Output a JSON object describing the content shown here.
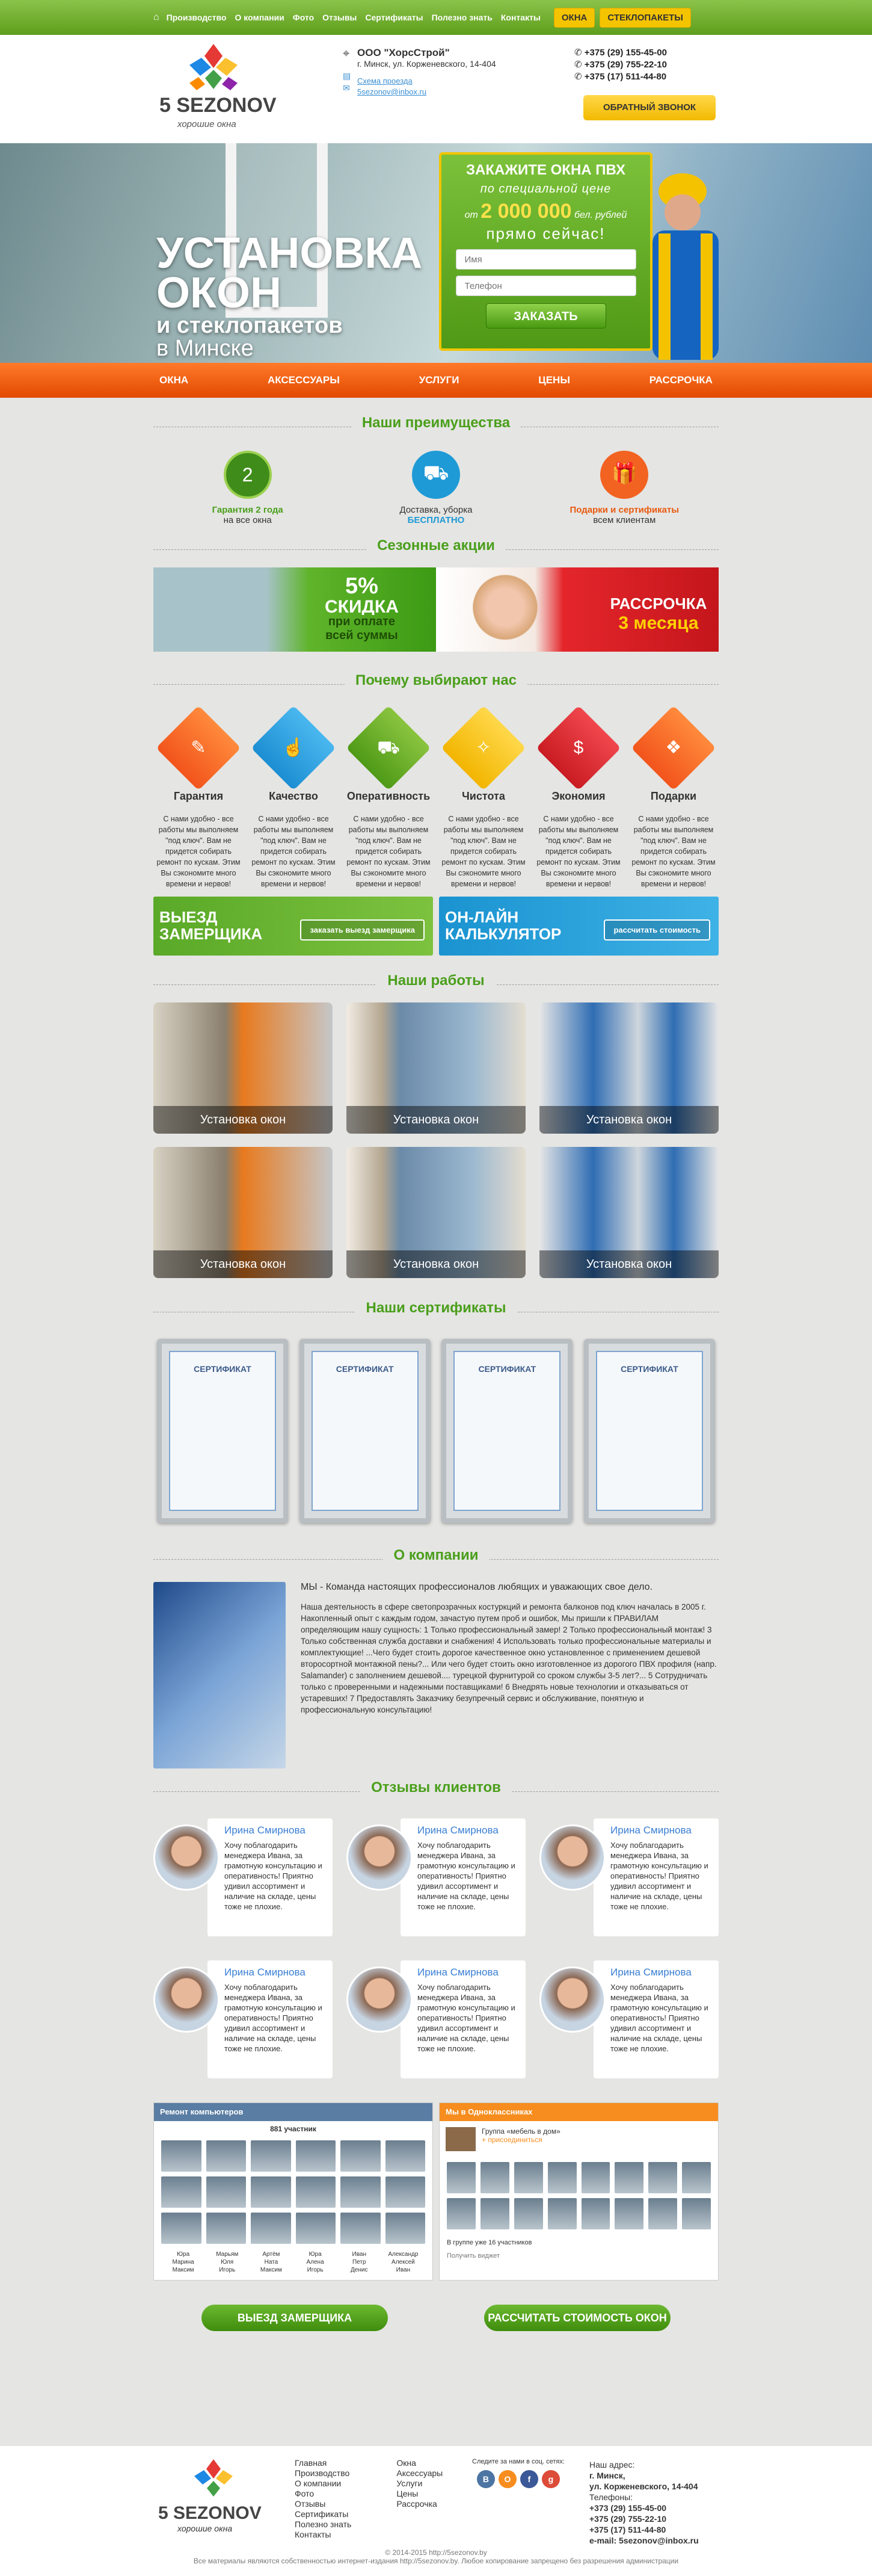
{
  "topnav": {
    "items": [
      "Производство",
      "О компании",
      "Фото",
      "Отзывы",
      "Сертификаты",
      "Полезно знать",
      "Контакты"
    ],
    "btn_windows": "ОКНА",
    "btn_glass": "СТЕКЛОПАКЕТЫ"
  },
  "header": {
    "logo_name": "5 SEZONOV",
    "logo_sub": "хорошие окна",
    "company": "ООО \"ХорсСтрой\"",
    "address": "г. Минск, ул. Корженевского, 14-404",
    "link1": "Схема проезда",
    "link2": "5sezonov@inbox.ru",
    "phones": [
      "+375 (29) 155-45-00",
      "+375 (29) 755-22-10",
      "+375 (17) 511-44-80"
    ],
    "callback": "ОБРАТНЫЙ ЗВОНОК"
  },
  "hero": {
    "line1": "УСТАНОВКА",
    "line2": "ОКОН",
    "line3": "и стеклопакетов",
    "line4": "в Минске",
    "form_title": "ЗАКАЖИТЕ ОКНА ПВХ",
    "form_sub": "по специальной цене",
    "form_from": "от",
    "form_price": "2 000 000",
    "form_currency": "бел. рублей",
    "form_now": "прямо сейчас!",
    "name_ph": "Имя",
    "phone_ph": "Телефон",
    "order": "ЗАКАЗАТЬ"
  },
  "orangenav": [
    "ОКНА",
    "АКСЕССУАРЫ",
    "УСЛУГИ",
    "ЦЕНЫ",
    "РАССРОЧКА"
  ],
  "advantages": {
    "title": "Наши преимущества",
    "items": [
      {
        "t": "Гарантия 2 года",
        "s": "на все окна"
      },
      {
        "t": "Доставка, уборка",
        "s": "БЕСПЛАТНО"
      },
      {
        "t": "Подарки и сертификаты",
        "s": "всем клиентам"
      }
    ],
    "badge": "2"
  },
  "promos": {
    "title": "Сезонные акции",
    "p1a": "5%",
    "p1b": "СКИДКА",
    "p1c": "при оплате",
    "p1d": "всей суммы",
    "p2a": "РАССРОЧКА",
    "p2b": "3 месяца"
  },
  "reasons": {
    "title": "Почему выбирают нас",
    "items": [
      "Гарантия",
      "Качество",
      "Оперативность",
      "Чистота",
      "Экономия",
      "Подарки"
    ],
    "text": "С нами удобно - все работы мы выполняем \"под ключ\". Вам не придется собирать ремонт по кускам. Этим Вы сэкономите много времени и нервов!",
    "banner1": "ВЫЕЗД ЗАМЕРЩИКА",
    "banner1_btn": "заказать выезд замерщика",
    "banner2": "ОН-ЛАЙН КАЛЬКУЛЯТОР",
    "banner2_btn": "рассчитать стоимость"
  },
  "works": {
    "title": "Наши работы",
    "caption": "Установка окон"
  },
  "certs": {
    "title": "Наши сертификаты",
    "label": "СЕРТИФИКАТ"
  },
  "about": {
    "title": "О компании",
    "lead": "МЫ - Команда настоящих профессионалов любящих и уважающих свое дело.",
    "body": "Наша деятельность в сфере светопрозрачных костуркций и ремонта балконов под ключ началась в 2005 г. Накопленный опыт с каждым годом, зачастую путем проб и ошибок, Мы пришли к ПРАВИЛАМ определяющим нашу сущность: 1 Только профессиональный замер! 2 Только профессиональный монтаж! 3 Только собственная служба доставки и снабжения! 4 Использовать только профессиональные материалы и комплектующие! ...Чего будет стоить дорогое качественное окно установленное с применением дешевой второсортной монтажной пены?... Или чего будет стоить окно изготовленное из дорогого ПВХ профиля (напр. Salamander) с заполнением дешевой.... турецкой фурнитурой со сроком службы 3-5 лет?... 5 Сотрудничать только с проверенными и надежными поставщиками! 6 Внедрять новые технологии и отказываться от устаревших! 7 Предоставлять Заказчику безупречный сервис и обслуживание, понятную и профессиональную консультацию!"
  },
  "reviews": {
    "title": "Отзывы клиентов",
    "name": "Ирина Смирнова",
    "text": "Хочу поблагодарить менеджера Ивана, за грамотную консультацию и оперативность! Приятно удивил ассортимент и наличие на складе, цены тоже не плохие."
  },
  "social": {
    "vk_title": "Ремонт компьютеров",
    "vk_members": "881 участник",
    "vk_names": [
      "Юра",
      "Марьям",
      "Артём",
      "Юра",
      "Иван",
      "Александр",
      "Марина",
      "Юля",
      "Ната",
      "Алена",
      "Петр",
      "Алексей",
      "Максим",
      "Игорь",
      "Максим",
      "Игорь",
      "Денис",
      "Иван"
    ],
    "ok_title": "Мы в Одноклассниках",
    "ok_group": "Группа «мебель в дом»",
    "ok_join": "+ присоединиться",
    "ok_members": "В группе уже 16 участников",
    "ok_widget": "Получить виджет"
  },
  "cta": {
    "b1": "ВЫЕЗД ЗАМЕРЩИКА",
    "b2": "РАССЧИТАТЬ СТОИМОСТЬ ОКОН"
  },
  "footer": {
    "col1": [
      "Главная",
      "Производство",
      "О компании",
      "Фото",
      "Отзывы",
      "Сертификаты",
      "Полезно знать",
      "Контакты"
    ],
    "col2": [
      "Окна",
      "Аксессуары",
      "Услуги",
      "Цены",
      "Рассрочка"
    ],
    "social_title": "Следите за нами в соц. сетях:",
    "addr_title": "Наш адрес:",
    "city": "г. Минск,",
    "street": "ул. Корженевского, 14-404",
    "phones_title": "Телефоны:",
    "phones": [
      "+373 (29) 155-45-00",
      "+375 (29) 755-22-10",
      "+375 (17) 511-44-80"
    ],
    "email": "e-mail: 5sezonov@inbox.ru",
    "copy1": "© 2014-2015 http://5sezonov.by",
    "copy2": "Все материалы являются собственностью интернет-издания http://5sezonov.by. Любое копирование запрещено без разрешения администрации"
  }
}
